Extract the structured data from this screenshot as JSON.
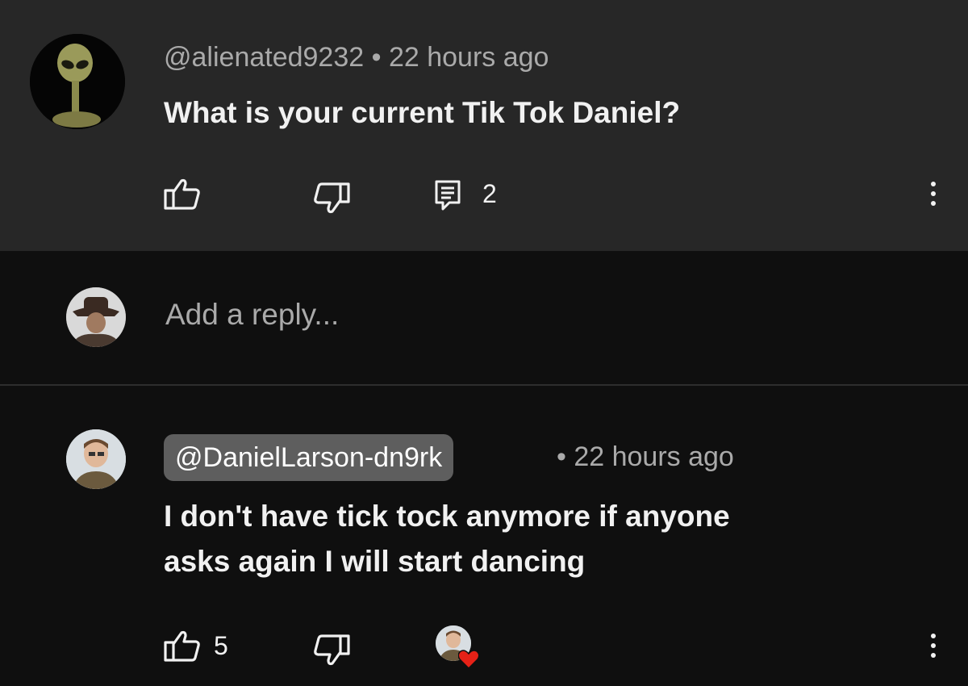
{
  "comment": {
    "author": "@alienated9232",
    "time": "• 22 hours ago",
    "text": "What is your current Tik Tok Daniel?",
    "reply_count": "2"
  },
  "reply_box": {
    "placeholder": "Add a reply..."
  },
  "reply": {
    "author": "@DanielLarson-dn9rk",
    "time": "• 22 hours ago",
    "text_line1": "I don't have tick tock anymore if anyone",
    "text_line2": "asks again I will start dancing",
    "like_count": "5"
  },
  "icons": {
    "like": "thumbs-up-icon",
    "dislike": "thumbs-down-icon",
    "reply": "comment-icon",
    "more": "kebab-menu-icon",
    "heart": "heart-icon"
  },
  "colors": {
    "top_bg": "#272727",
    "page_bg": "#0f0f0f",
    "meta": "#aaaaaa",
    "chip_bg": "#5e5e5e",
    "heart": "#e62117"
  }
}
